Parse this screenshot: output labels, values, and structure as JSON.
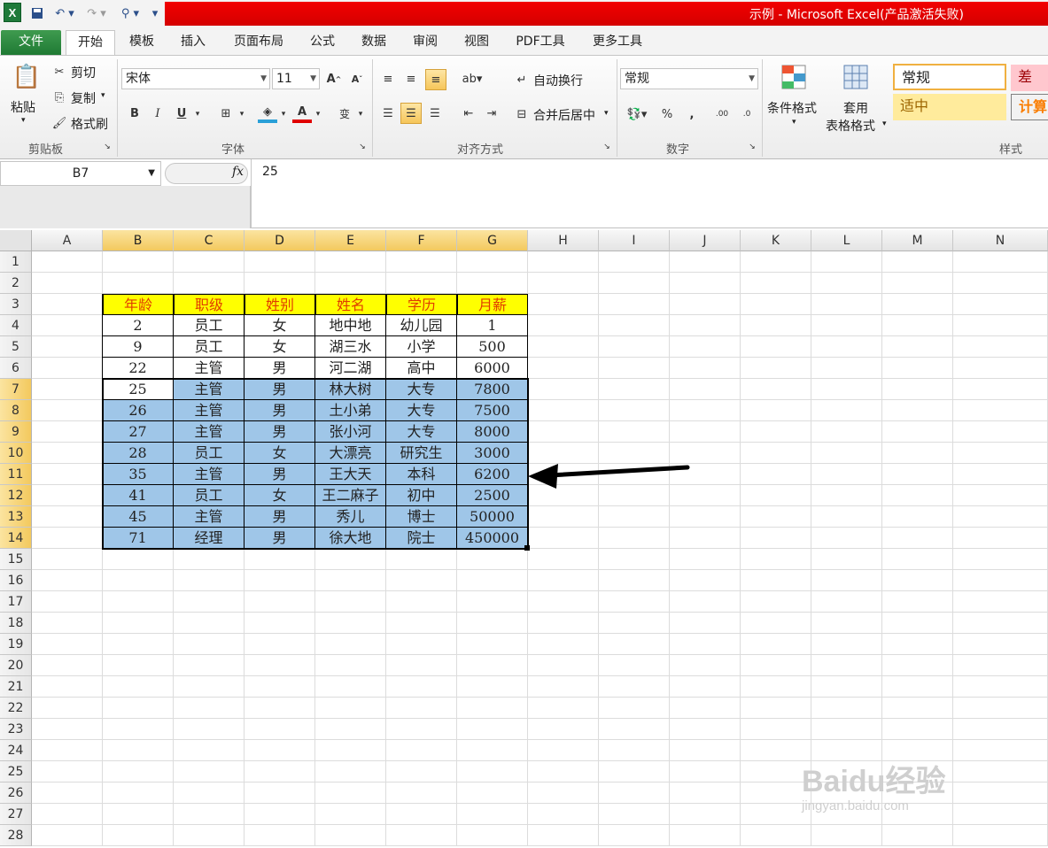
{
  "window": {
    "title": "示例 - Microsoft Excel(产品激活失败)"
  },
  "tabs": [
    "文件",
    "开始",
    "模板",
    "插入",
    "页面布局",
    "公式",
    "数据",
    "审阅",
    "视图",
    "PDF工具",
    "更多工具"
  ],
  "ribbon": {
    "clipboard": {
      "paste": "粘贴",
      "cut": "剪切",
      "copy": "复制",
      "format_painter": "格式刷",
      "label": "剪贴板"
    },
    "font": {
      "font_name": "宋体",
      "font_size": "11",
      "label": "字体"
    },
    "alignment": {
      "wrap_text": "自动换行",
      "merge_center": "合并后居中",
      "label": "对齐方式"
    },
    "number": {
      "format": "常规",
      "label": "数字"
    },
    "styles": {
      "conditional": "条件格式",
      "table_format_1": "套用",
      "table_format_2": "表格格式",
      "normal": "常规",
      "bad": "差",
      "neutral": "适中",
      "calc": "计算",
      "label": "样式"
    }
  },
  "formula_bar": {
    "name_box": "B7",
    "fx": "fx",
    "value": "25"
  },
  "sheet": {
    "columns": [
      "A",
      "B",
      "C",
      "D",
      "E",
      "F",
      "G",
      "H",
      "I",
      "J",
      "K",
      "L",
      "M",
      "N"
    ],
    "rows": [
      "1",
      "2",
      "3",
      "4",
      "5",
      "6",
      "7",
      "8",
      "9",
      "10",
      "11",
      "12",
      "13",
      "14",
      "15",
      "16",
      "17",
      "18",
      "19",
      "20",
      "21",
      "22",
      "23",
      "24",
      "25",
      "26",
      "27",
      "28"
    ],
    "header_row": [
      "年龄",
      "职级",
      "姓别",
      "姓名",
      "学历",
      "月薪"
    ],
    "data": [
      [
        "2",
        "员工",
        "女",
        "地中地",
        "幼儿园",
        "1"
      ],
      [
        "9",
        "员工",
        "女",
        "湖三水",
        "小学",
        "500"
      ],
      [
        "22",
        "主管",
        "男",
        "河二湖",
        "高中",
        "6000"
      ],
      [
        "25",
        "主管",
        "男",
        "林大树",
        "大专",
        "7800"
      ],
      [
        "26",
        "主管",
        "男",
        "土小弟",
        "大专",
        "7500"
      ],
      [
        "27",
        "主管",
        "男",
        "张小河",
        "大专",
        "8000"
      ],
      [
        "28",
        "员工",
        "女",
        "大漂亮",
        "研究生",
        "3000"
      ],
      [
        "35",
        "主管",
        "男",
        "王大天",
        "本科",
        "6200"
      ],
      [
        "41",
        "员工",
        "女",
        "王二麻子",
        "初中",
        "2500"
      ],
      [
        "45",
        "主管",
        "男",
        "秀儿",
        "博士",
        "50000"
      ],
      [
        "71",
        "经理",
        "男",
        "徐大地",
        "院士",
        "450000"
      ]
    ]
  },
  "watermark": {
    "main": "Baidu经验",
    "sub": "jingyan.baidu.com"
  }
}
